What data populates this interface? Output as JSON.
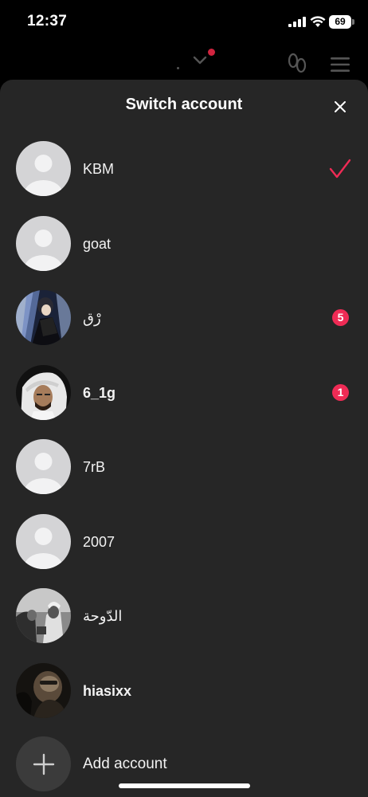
{
  "status_bar": {
    "time": "12:37",
    "battery": "69"
  },
  "sheet": {
    "title": "Switch account"
  },
  "accounts": [
    {
      "name": "KBM",
      "avatar": "default",
      "selected": true
    },
    {
      "name": "goat",
      "avatar": "default"
    },
    {
      "name": "رْق",
      "avatar": "anime-character",
      "badge": "5"
    },
    {
      "name": "6_1g",
      "avatar": "photo-man-ghutra",
      "badge": "1",
      "bold": true
    },
    {
      "name": "7rB",
      "avatar": "default"
    },
    {
      "name": "2007",
      "avatar": "default"
    },
    {
      "name": "الدّوحة",
      "avatar": "photo-bw-group"
    },
    {
      "name": "hiasixx",
      "avatar": "photo-dark-portrait",
      "bold": true
    }
  ],
  "add_account": {
    "label": "Add account"
  },
  "colors": {
    "accent": "#ef2b55",
    "sheet_bg": "#262626",
    "check": "#ef2b55"
  }
}
